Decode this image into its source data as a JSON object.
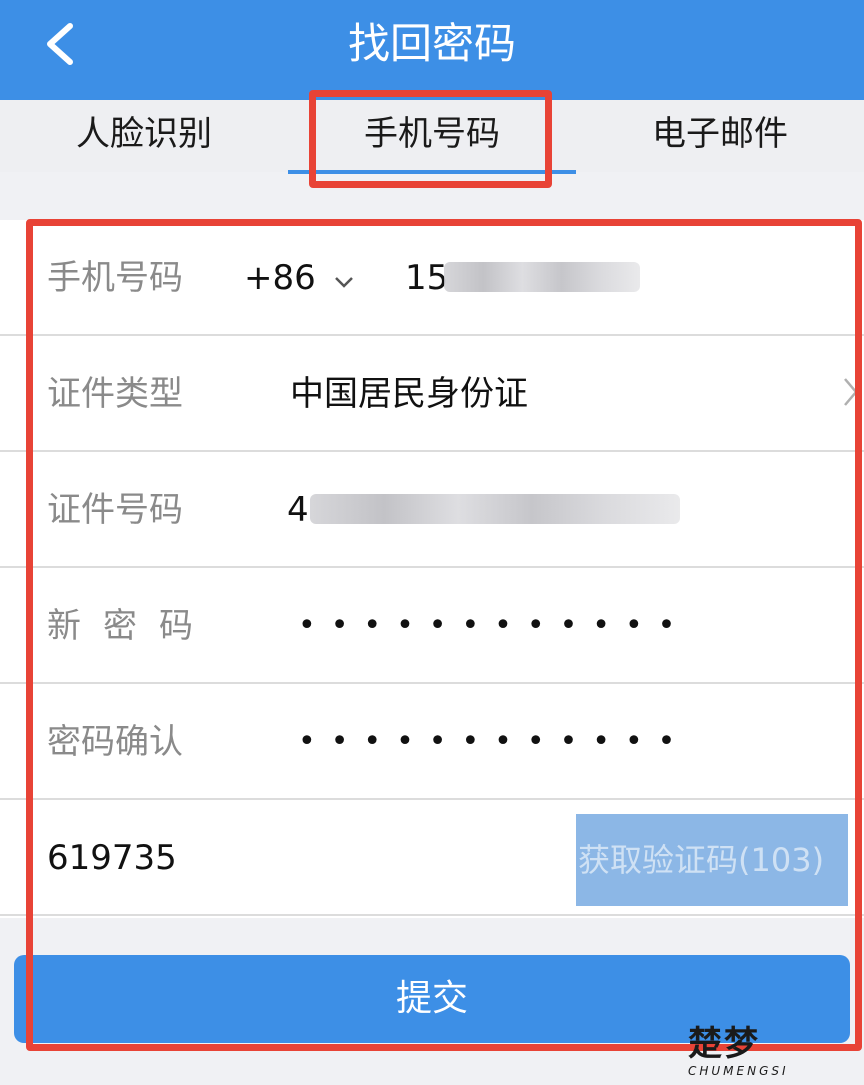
{
  "header": {
    "title": "找回密码"
  },
  "tabs": [
    {
      "label": "人脸识别"
    },
    {
      "label": "手机号码"
    },
    {
      "label": "电子邮件"
    }
  ],
  "form": {
    "phone": {
      "label": "手机号码",
      "country_code": "+86",
      "value_visible": "15"
    },
    "id_type": {
      "label": "证件类型",
      "value": "中国居民身份证"
    },
    "id_number": {
      "label": "证件号码",
      "value_visible": "4"
    },
    "new_password": {
      "label": "新密码",
      "masked": "••••••••••••"
    },
    "confirm_password": {
      "label": "密码确认",
      "masked": "••••••••••••"
    },
    "verification": {
      "value": "619735",
      "get_code_label": "获取验证码(103)"
    }
  },
  "submit_label": "提交",
  "watermark": {
    "mark": "楚梦",
    "sub": "CHUMENGSI"
  },
  "colors": {
    "accent": "#3d8fe6",
    "highlight": "#e84336",
    "code_button": "#8cb7e6"
  }
}
